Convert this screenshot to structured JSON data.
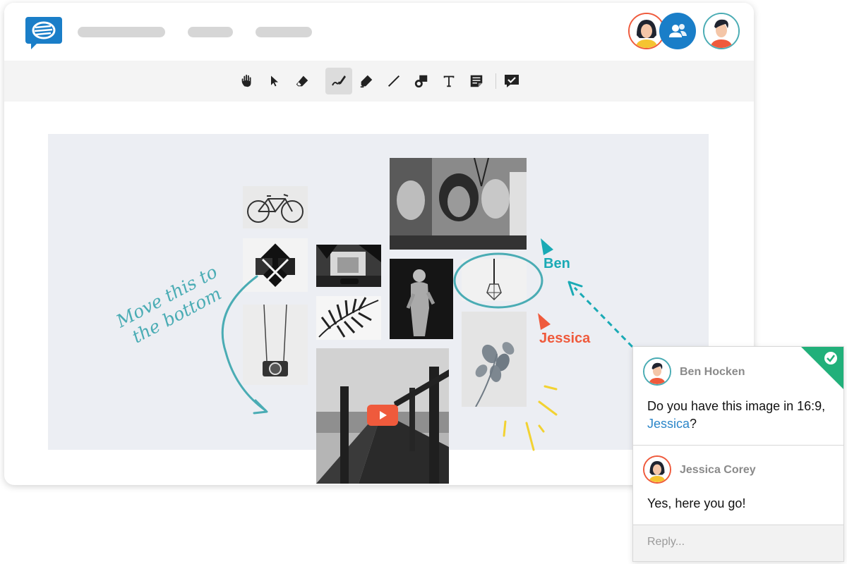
{
  "annotation": {
    "note_line1": "Move this to",
    "note_line2": "the bottom"
  },
  "cursors": [
    {
      "label": "Ben",
      "color": "#1aaab5"
    },
    {
      "label": "Jessica",
      "color": "#ef5a3c"
    }
  ],
  "comments": [
    {
      "author": "Ben Hocken",
      "text_before": "Do you have this image in 16:9, ",
      "mention": "Jessica",
      "text_after": "?"
    },
    {
      "author": "Jessica Corey",
      "text": "Yes, here you go!"
    }
  ],
  "reply_placeholder": "Reply...",
  "colors": {
    "brand": "#1a7ec8",
    "accent_teal": "#4aacb4",
    "resolved_green": "#21b07a",
    "cursor_red": "#ef5a3c"
  },
  "toolbar_icons": [
    "hand-icon",
    "pointer-icon",
    "eraser-icon",
    "pen-icon",
    "highlighter-icon",
    "line-icon",
    "shapes-icon",
    "text-icon",
    "sticky-note-icon",
    "comment-icon"
  ]
}
